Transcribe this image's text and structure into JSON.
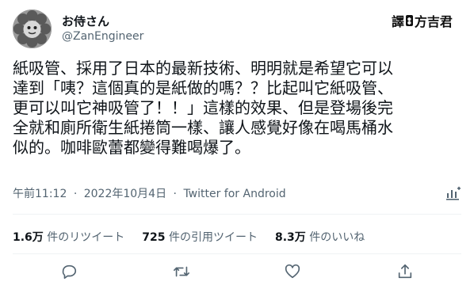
{
  "author": {
    "name": "お侍さん",
    "handle": "@ZanEngineer"
  },
  "translator_badge": {
    "prefix": "譯",
    "separator": ":",
    "name": "方吉君"
  },
  "tweet": {
    "lines": [
      "紙吸管、採用了日本的最新技術、明明就是希望它可以",
      "達到「咦？這個真的是紙做的嗎？？比起叫它紙吸管、",
      "更可以叫它神吸管了！！」這樣的效果、但是登場後完",
      "全就和廁所衛生紙捲筒一樣、讓人感覺好像在喝馬桶水",
      "似的。咖啡歐蕾都變得難喝爆了。"
    ]
  },
  "meta": {
    "time": "午前11:12",
    "date": "2022年10月4日",
    "source": "Twitter for Android",
    "dot": "·"
  },
  "stats": [
    {
      "count": "1.6万",
      "label": "件のリツイート"
    },
    {
      "count": "725",
      "label": "件の引用ツイート"
    },
    {
      "count": "8.3万",
      "label": "件のいいね"
    }
  ],
  "icons": {
    "analytics": "analytics-icon",
    "reply": "reply-icon",
    "retweet": "retweet-icon",
    "like": "heart-icon",
    "share": "share-icon"
  },
  "colors": {
    "text": "#0f1419",
    "secondary": "#536471",
    "divider": "#eff3f4"
  }
}
